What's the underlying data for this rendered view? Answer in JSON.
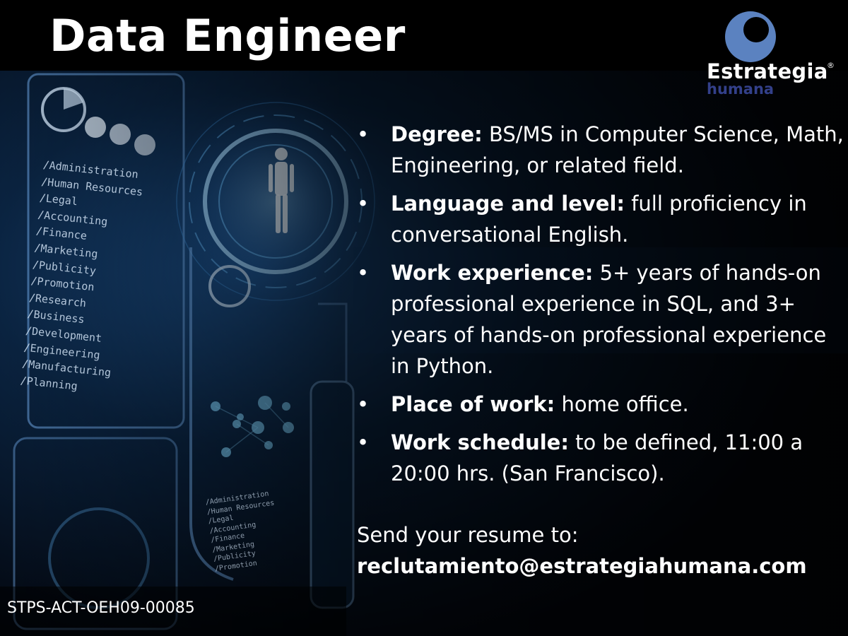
{
  "title": "Data Engineer",
  "logo": {
    "line1": "Estrategia",
    "line2": "humana",
    "registered": "®"
  },
  "requirements": [
    {
      "label": "Degree:",
      "text": "BS/MS in Computer Science, Math, Engineering, or related field."
    },
    {
      "label": "Language and level:",
      "text": "full proficiency in conversational English."
    },
    {
      "label": "Work experience:",
      "text": "5+ years of hands-on professional experience in SQL, and 3+ years of hands-on professional experience in Python."
    },
    {
      "label": "Place of work:",
      "text": "home office."
    },
    {
      "label": "Work schedule:",
      "text": " to be defined, 11:00 a 20:00 hrs. (San Francisco)."
    }
  ],
  "bullet": "•",
  "contact": {
    "prompt": "Send your resume to:",
    "email": "reclutamiento@estrategiahumana.com"
  },
  "certification": "STPS-ACT-OEH09-00085",
  "background_menu": [
    "/Administration",
    "/Human Resources",
    "/Legal",
    "/Accounting",
    "/Finance",
    "/Marketing",
    "/Publicity",
    "/Promotion",
    "/Research",
    "/Business",
    "/Development",
    "/Engineering",
    "/Manufacturing",
    "/Planning"
  ],
  "colors": {
    "logo_blue": "#5b82c0",
    "logo_dark": "#33408a",
    "glow": "#2a7bd8",
    "text": "#ffffff"
  }
}
